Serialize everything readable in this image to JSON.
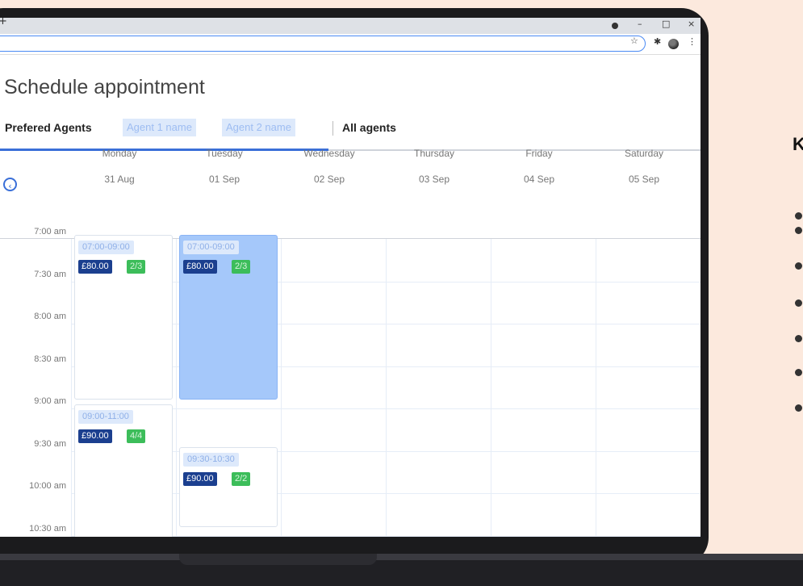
{
  "page": {
    "title": "Schedule appointment",
    "agents_label": "Prefered Agents",
    "agent_chips": [
      "Agent 1 name",
      "Agent 2 name"
    ],
    "all_agents": "All agents",
    "side_heading": "K"
  },
  "browser": {
    "new_tab_icon": "+",
    "window_controls": [
      "–",
      "□",
      "×"
    ],
    "bookmark_icon": "☆",
    "extensions_icon": "✱",
    "menu_icon": "⋮"
  },
  "calendar": {
    "back_icon": "‹",
    "days": [
      {
        "name": "Monday",
        "date": "31 Aug"
      },
      {
        "name": "Tuesday",
        "date": "01 Sep"
      },
      {
        "name": "Wednesday",
        "date": "02 Sep"
      },
      {
        "name": "Thursday",
        "date": "03 Sep"
      },
      {
        "name": "Friday",
        "date": "04 Sep"
      },
      {
        "name": "Saturday",
        "date": "05 Sep"
      }
    ],
    "times": [
      "7:00 am",
      "7:30 am",
      "8:00 am",
      "8:30 am",
      "9:00 am",
      "9:30 am",
      "10:00 am",
      "10:30 am"
    ],
    "slots": [
      {
        "day": 0,
        "start": "7:00 am",
        "end": "9:00 am",
        "time": "07:00-09:00",
        "price": "£80.00",
        "capacity": "2/3",
        "selected": false
      },
      {
        "day": 1,
        "start": "7:00 am",
        "end": "9:00 am",
        "time": "07:00-09:00",
        "price": "£80.00",
        "capacity": "2/3",
        "selected": true
      },
      {
        "day": 0,
        "start": "9:00 am",
        "end": "11:00 am",
        "time": "09:00-11:00",
        "price": "£90.00",
        "capacity": "4/4",
        "selected": false
      },
      {
        "day": 1,
        "start": "9:30 am",
        "end": "10:30 am",
        "time": "09:30-10:30",
        "price": "£90.00",
        "capacity": "2/2",
        "selected": false
      }
    ]
  },
  "colors": {
    "accent": "#3a6fd8",
    "price_badge": "#1b3f8f",
    "capacity_badge": "#3cbd5a",
    "selected_slot": "#a5c8fa",
    "background": "#fce9dd"
  }
}
